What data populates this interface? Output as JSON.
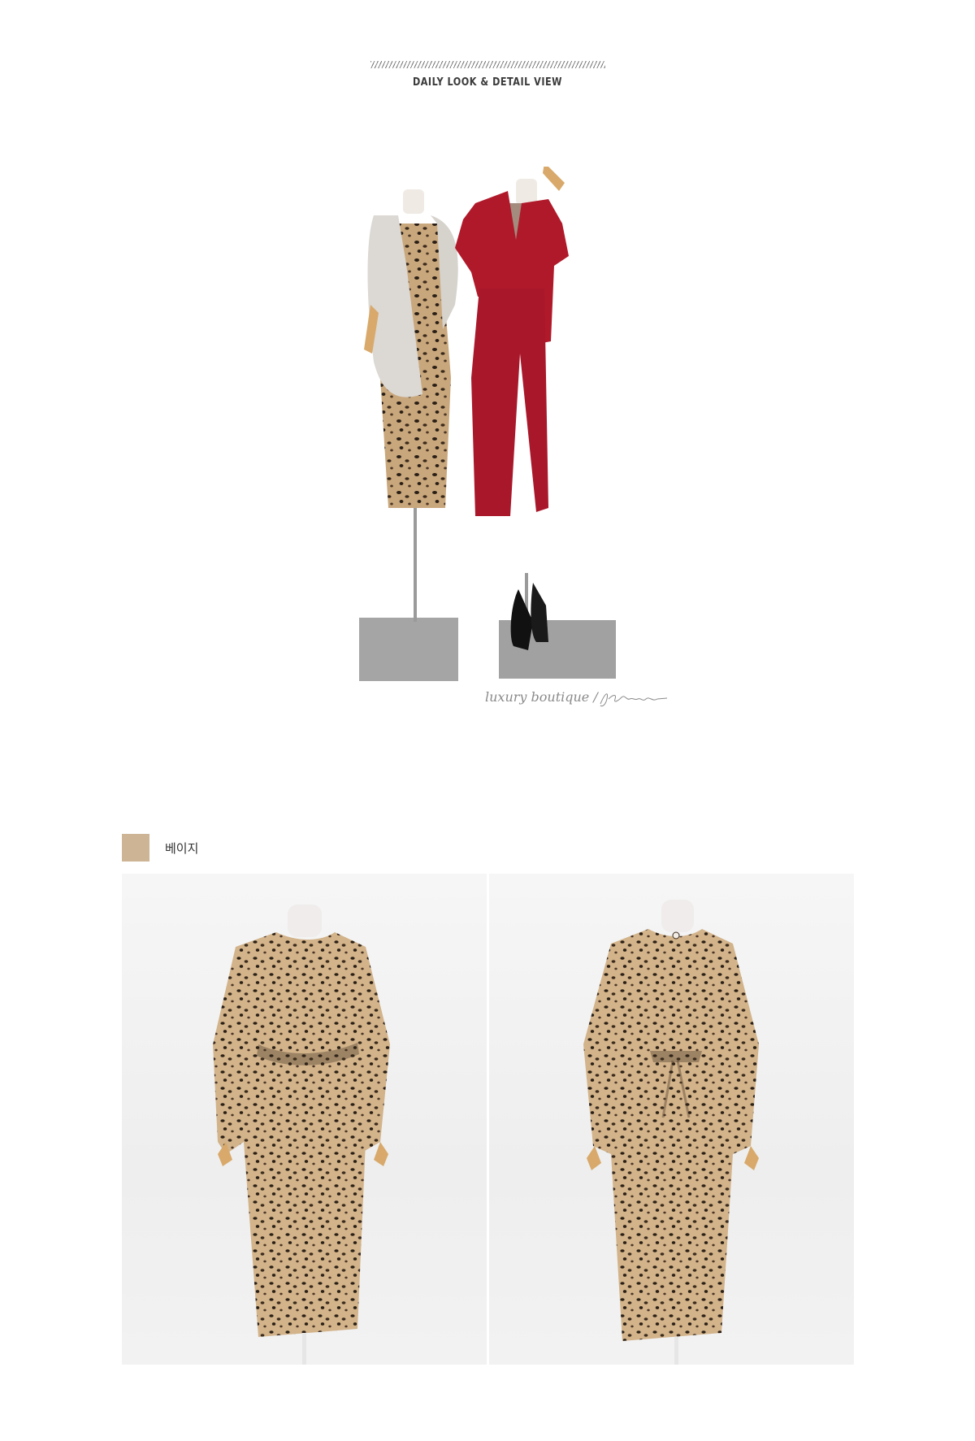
{
  "header": {
    "title": "DAILY LOOK & DETAIL VIEW"
  },
  "look": {
    "caption": "luxury boutique /",
    "signature_brand": "Jblanc"
  },
  "color_option": {
    "swatch_color": "#cdb494",
    "label": "베이지"
  },
  "colors": {
    "red_suit": "#b0192a",
    "fur_vest": "#dcd8d3",
    "leopard_base": "#c9a77c",
    "stand_plate": "#a3a3a3"
  }
}
